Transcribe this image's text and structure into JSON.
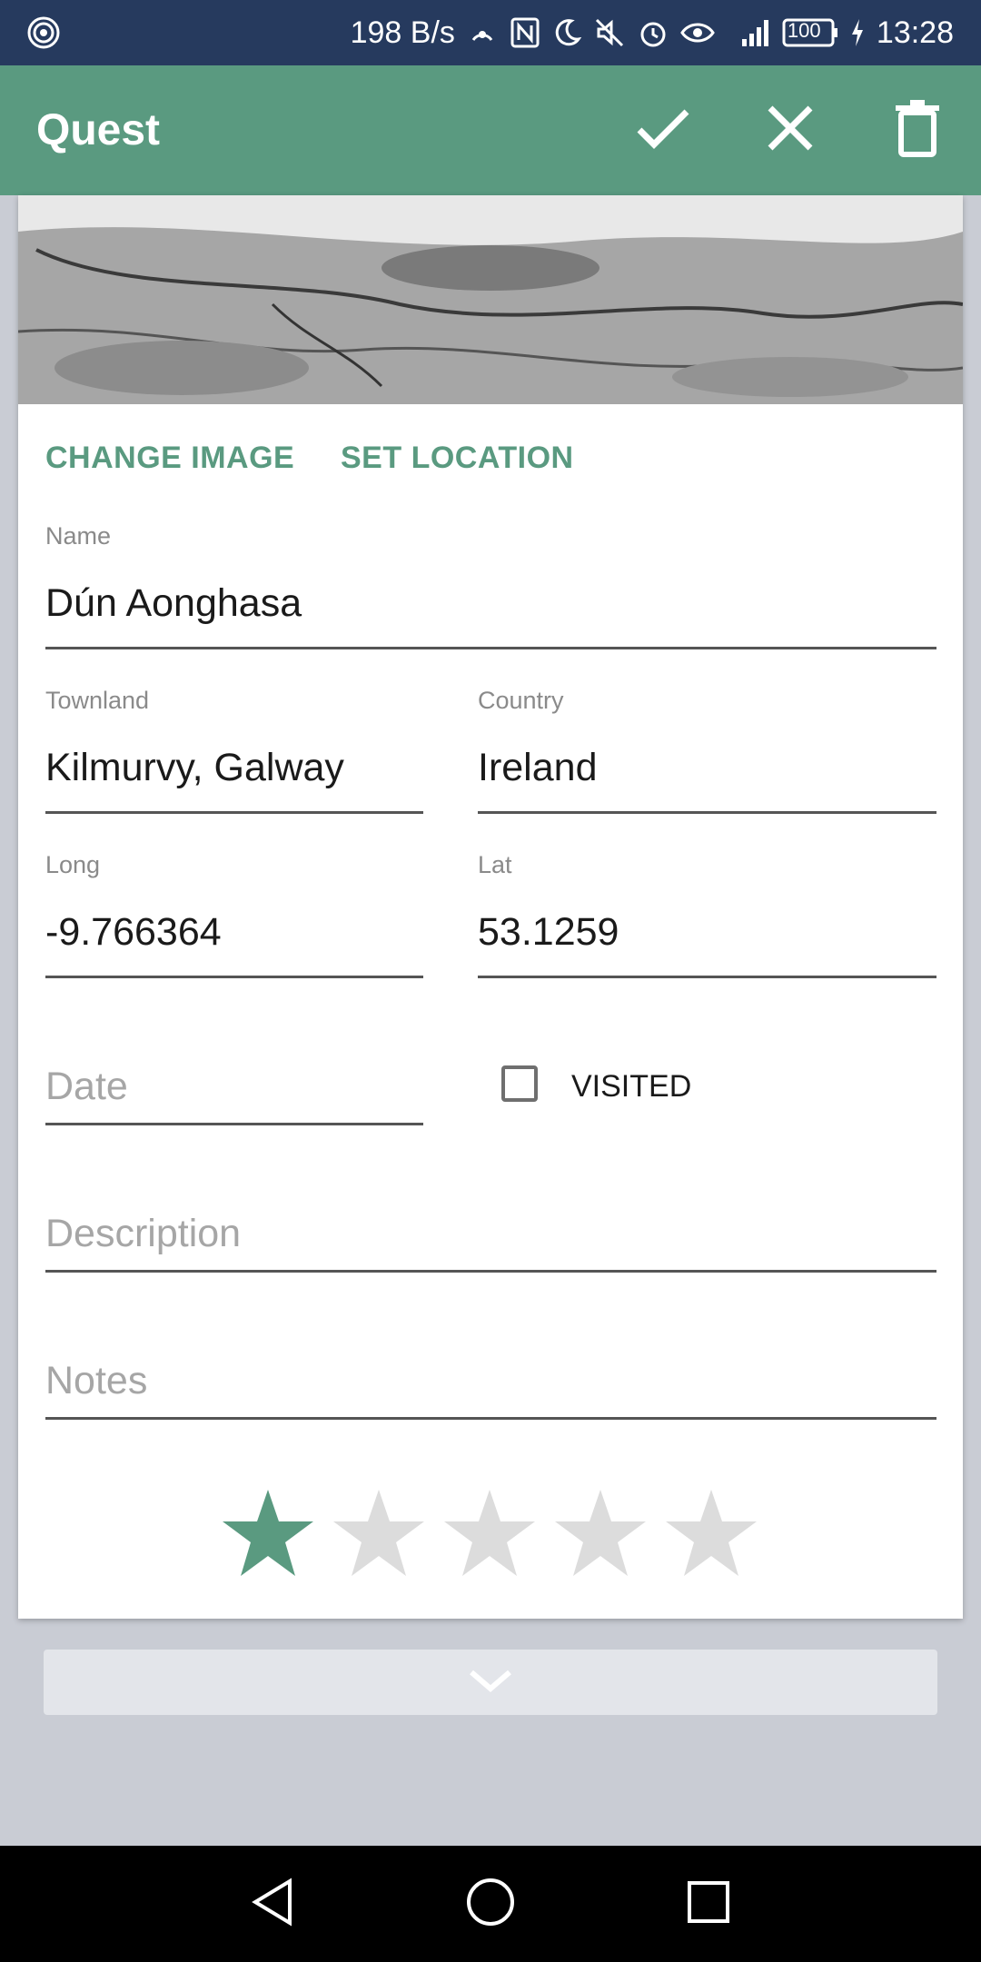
{
  "status_bar": {
    "network_speed": "198 B/s",
    "battery": "100",
    "time": "13:28",
    "icons": [
      "hotspot-icon",
      "nfc-icon",
      "moon-icon",
      "mute-icon",
      "alarm-icon",
      "eye-icon",
      "signal-icon",
      "battery-icon",
      "charging-icon"
    ]
  },
  "app_bar": {
    "title": "Quest",
    "actions": [
      "check-icon",
      "close-icon",
      "delete-icon"
    ]
  },
  "actions": {
    "change_image": "CHANGE IMAGE",
    "set_location": "SET LOCATION"
  },
  "form": {
    "name": {
      "label": "Name",
      "value": "Dún Aonghasa"
    },
    "townland": {
      "label": "Townland",
      "value": "Kilmurvy, Galway"
    },
    "country": {
      "label": "Country",
      "value": "Ireland"
    },
    "long": {
      "label": "Long",
      "value": "-9.766364"
    },
    "lat": {
      "label": "Lat",
      "value": "53.1259"
    },
    "date": {
      "placeholder": "Date"
    },
    "visited": {
      "label": "VISITED",
      "checked": false
    },
    "description": {
      "placeholder": "Description"
    },
    "notes": {
      "placeholder": "Notes"
    }
  },
  "rating": {
    "value": 1,
    "max": 5
  },
  "colors": {
    "accent": "#5a9a80",
    "status_bar": "#263a5e",
    "star_empty": "#dcdcdc"
  }
}
